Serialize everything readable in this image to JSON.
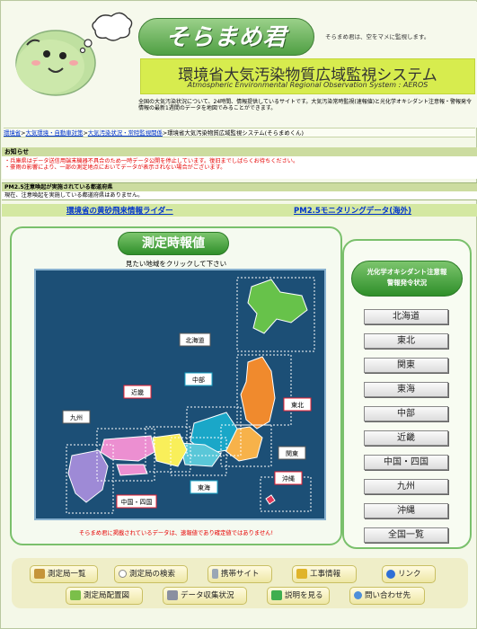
{
  "header": {
    "logo_text": "そらまめ君",
    "tagline": "そらまめ君は、空をマメに監視します。",
    "title_ja": "環境省大気汚染物質広域監視システム",
    "title_en": "Atmospheric Environmental Regional Observation System : AEROS",
    "intro": "全国の大気汚染状況について、24時間、情報提供しているサイトです。大気汚染常時監視(速報値)と光化学オキシダント注意報・警報発令情報の最新1週間のデータを地図でみることができます。"
  },
  "breadcrumb": {
    "items": [
      "環境省",
      "大気環境・自動車対策",
      "大気汚染状況・常時監視関係"
    ],
    "separator": ">",
    "current": "環境省大気汚染物質広域監視システム(そらまめくん)"
  },
  "notice": {
    "heading": "お知らせ",
    "lines": [
      "・兵庫県はデータ送信用端末機器不具合のため一時データ公開を停止しています。復旧までしばらくお待ちください。",
      "・豪雨の影響により、一部の測定地点においてデータが表示されない場合がございます。"
    ]
  },
  "pm25_alert": {
    "heading": "PM2.5注意喚起が実施されている都道府県",
    "body": "現在、注意喚起を実施している都道府県はありません。"
  },
  "links": {
    "left": "環境省の黄砂飛来情報ライダー",
    "right": "PM2.5モニタリングデータ(海外)"
  },
  "map": {
    "heading": "測定時報値",
    "caption": "見たい地域をクリックして下さい",
    "note": "そらまめ君に掲載されているデータは、速報値であり確定値ではありません!",
    "regions": [
      "北海道",
      "東北",
      "関東",
      "中部",
      "近畿",
      "九州",
      "中国・四国",
      "東海",
      "沖縄"
    ]
  },
  "oxidant": {
    "heading_lines": [
      "光化学オキシダント注意報",
      "警報発令状況"
    ],
    "buttons": [
      "北海道",
      "東北",
      "関東",
      "東海",
      "中部",
      "近畿",
      "中国・四国",
      "九州",
      "沖縄",
      "全国一覧"
    ]
  },
  "footer": {
    "buttons": [
      "測定局一覧",
      "測定局の検索",
      "携帯サイト",
      "工事情報",
      "リンク",
      "測定局配置図",
      "データ収集状況",
      "説明を見る",
      "問い合わせ先"
    ]
  },
  "colors": {
    "accent_green": "#3a9a34",
    "title_band": "#d7ec4e",
    "notice_red": "#e60000",
    "map_sea": "#1c4f76",
    "link_blue": "#0033cc"
  }
}
